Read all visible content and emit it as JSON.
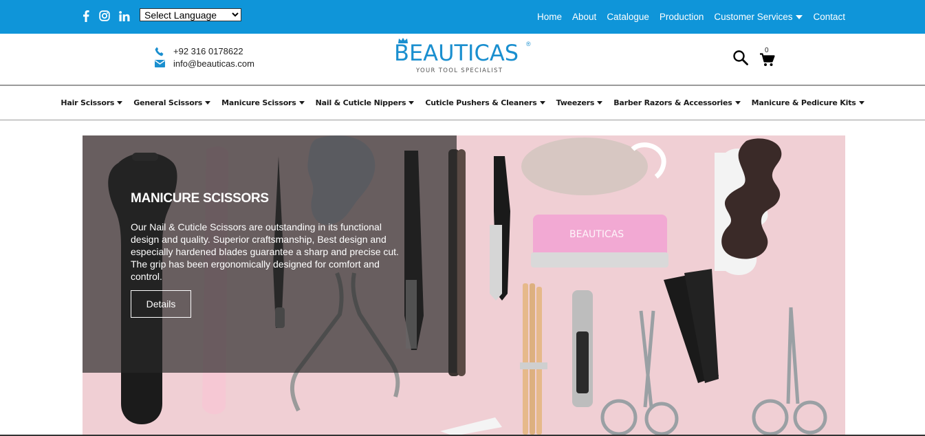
{
  "topbar": {
    "language_select": "Select Language",
    "nav": [
      {
        "label": "Home"
      },
      {
        "label": "About"
      },
      {
        "label": "Catalogue"
      },
      {
        "label": "Production"
      },
      {
        "label": "Customer Services",
        "dropdown": true
      },
      {
        "label": "Contact"
      }
    ],
    "social_icons": [
      "facebook-icon",
      "instagram-icon",
      "linkedin-icon"
    ],
    "background": "#0f95d9"
  },
  "header": {
    "phone": "+92 316 0178622",
    "email": "info@beauticas.com",
    "logo_text": "BEAUTICAS",
    "logo_reg": "®",
    "logo_tagline": "YOUR TOOL SPECIALIST",
    "cart_count": "0",
    "brand_color": "#1a8fcf"
  },
  "categories": [
    "Hair Scissors",
    "General Scissors",
    "Manicure Scissors",
    "Nail & Cuticle Nippers",
    "Cuticle Pushers & Cleaners",
    "Tweezers",
    "Barber Razors & Accessories",
    "Manicure & Pedicure Kits"
  ],
  "hero": {
    "title": "MANICURE SCISSORS",
    "description": "Our Nail & Cuticle Scissors are outstanding in its functional design and quality. Superior craftsmanship, Best design and especially hardened blades guarantee a sharp and precise cut. The grip has been ergonomically designed for comfort and control.",
    "button_label": "Details",
    "product_logo": "BEAUTICAS",
    "background": "#f0cfd4"
  }
}
